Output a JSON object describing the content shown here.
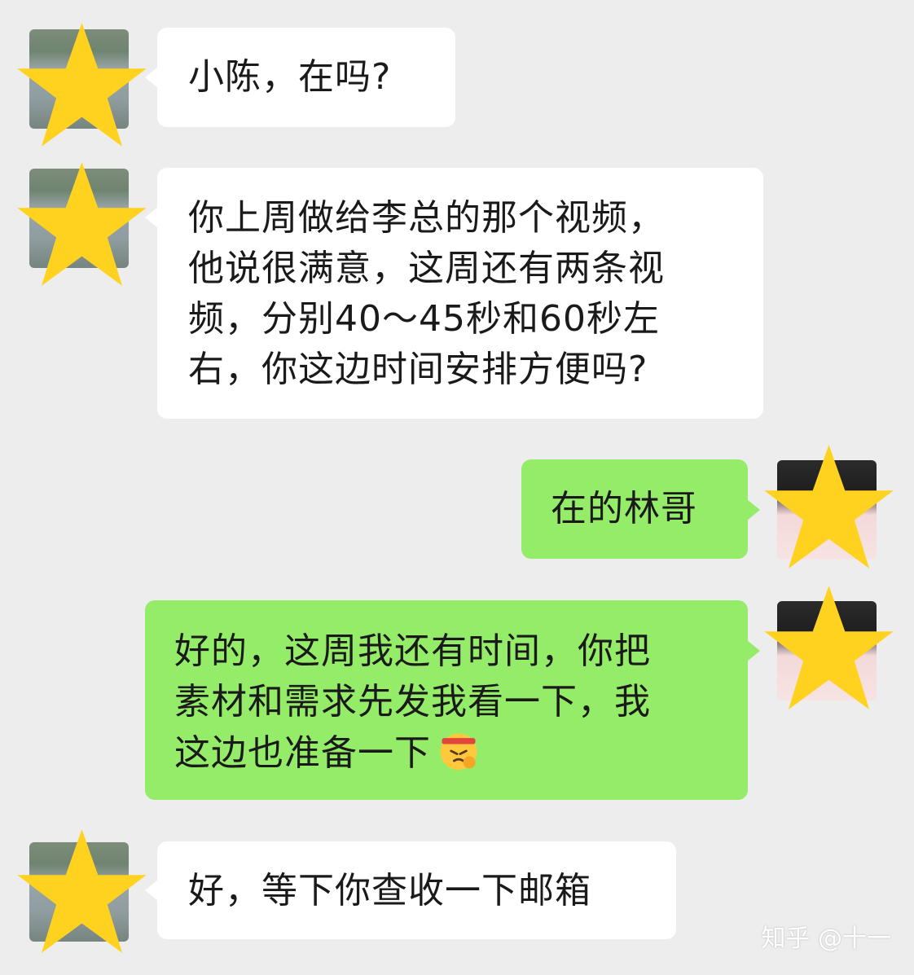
{
  "colors": {
    "background": "#ededed",
    "incoming_bubble": "#ffffff",
    "outgoing_bubble": "#95ec69",
    "star": "#ffd21f"
  },
  "messages": [
    {
      "direction": "incoming",
      "text": "小陈，在吗?"
    },
    {
      "direction": "incoming",
      "text": "你上周做给李总的那个视频，\n他说很满意，这周还有两条视\n频，分别40～45秒和60秒左\n右，你这边时间安排方便吗?"
    },
    {
      "direction": "outgoing",
      "text": "在的林哥"
    },
    {
      "direction": "outgoing",
      "text": "好的，这周我还有时间，你把\n素材和需求先发我看一下，我\n这边也准备一下",
      "emoji": "fighting-face-emoji"
    },
    {
      "direction": "incoming",
      "text": "好，等下你查收一下邮箱"
    }
  ],
  "watermark": "知乎 @十一"
}
